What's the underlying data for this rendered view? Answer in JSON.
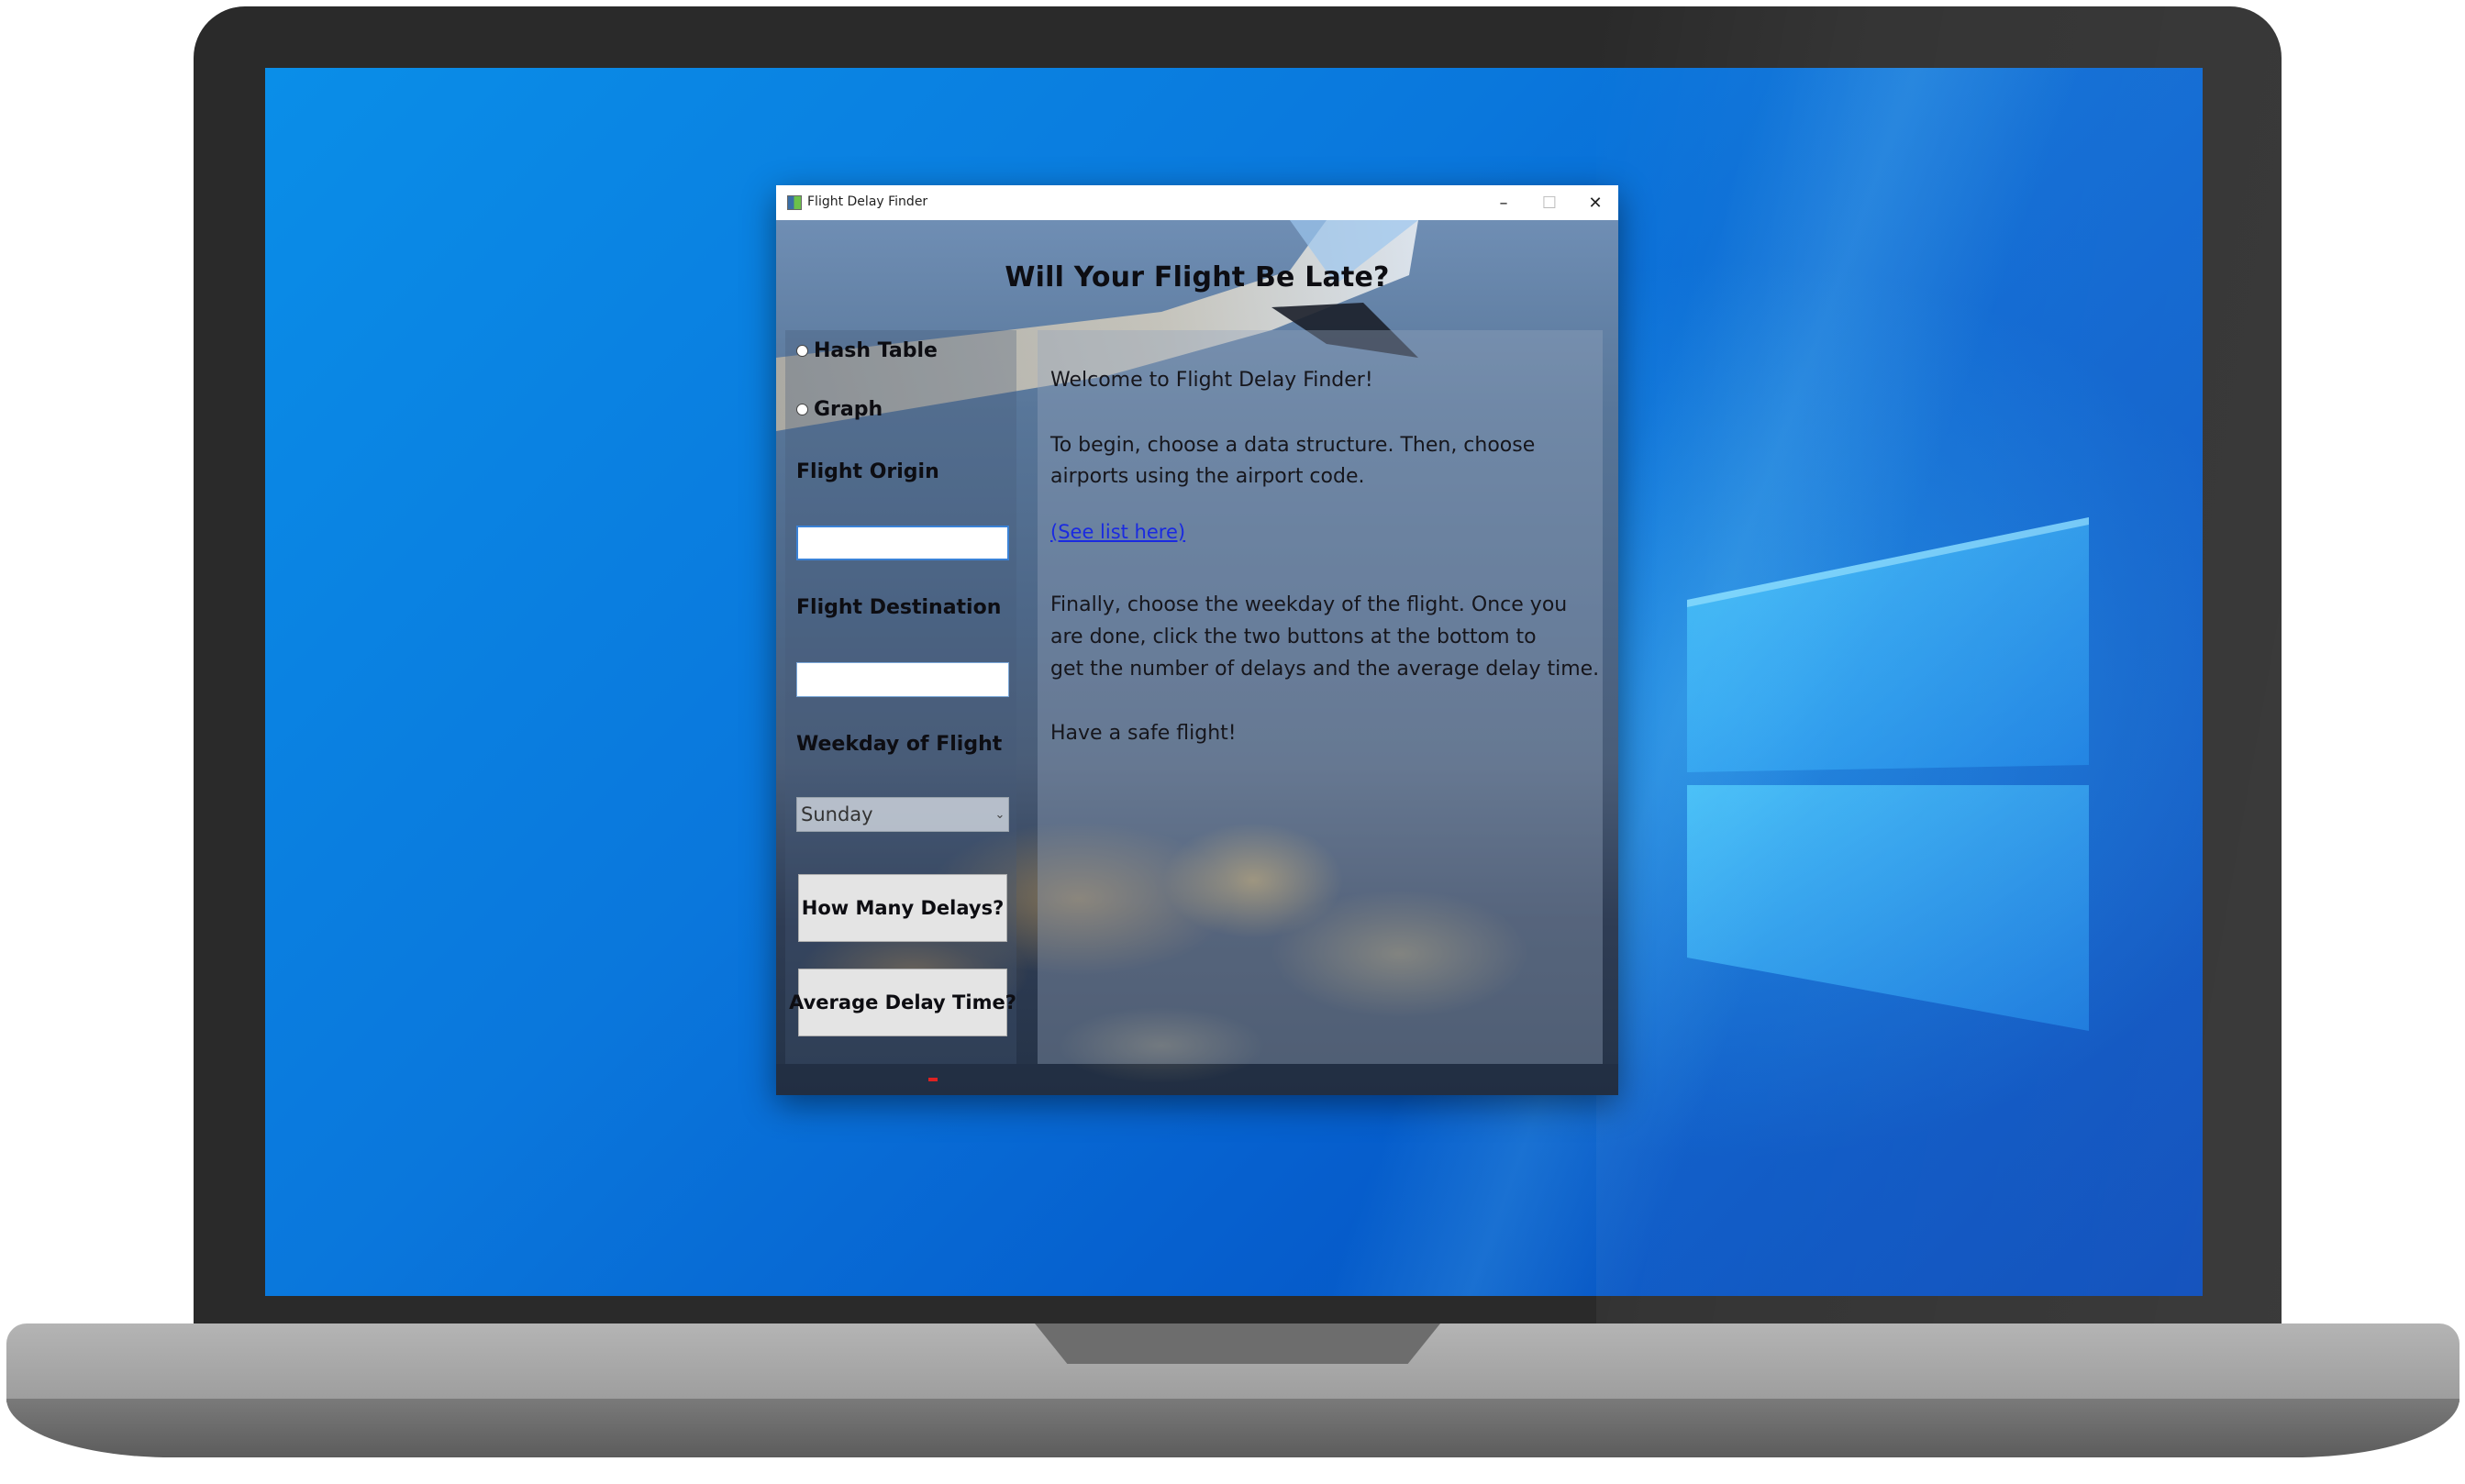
{
  "window": {
    "title": "Flight Delay Finder",
    "minimize_glyph": "–",
    "maximize_glyph": "☐",
    "close_glyph": "✕"
  },
  "heading": "Will Your Flight Be Late?",
  "data_structure_options": [
    {
      "label": "Hash Table",
      "selected": false
    },
    {
      "label": "Graph",
      "selected": false
    }
  ],
  "origin": {
    "label": "Flight Origin",
    "value": ""
  },
  "destination": {
    "label": "Flight Destination",
    "value": ""
  },
  "weekday": {
    "label": "Weekday of Flight",
    "selected": "Sunday"
  },
  "buttons": {
    "count": "How Many Delays?",
    "average": "Average Delay Time?"
  },
  "info": {
    "welcome": "Welcome to Flight Delay Finder!",
    "begin_line1": "To begin, choose a data structure. Then, choose",
    "begin_line2": "airports using the airport code.",
    "link": "(See list here)",
    "finally_line1": "Finally, choose the weekday of the flight. Once you",
    "finally_line2": "are done, click the two buttons at the bottom to",
    "finally_line3": "get the number of delays and the average delay time.",
    "closing": "Have a safe flight!"
  },
  "colors": {
    "desktop_blue": "#0a77dc",
    "link_blue": "#1a2ae0"
  }
}
